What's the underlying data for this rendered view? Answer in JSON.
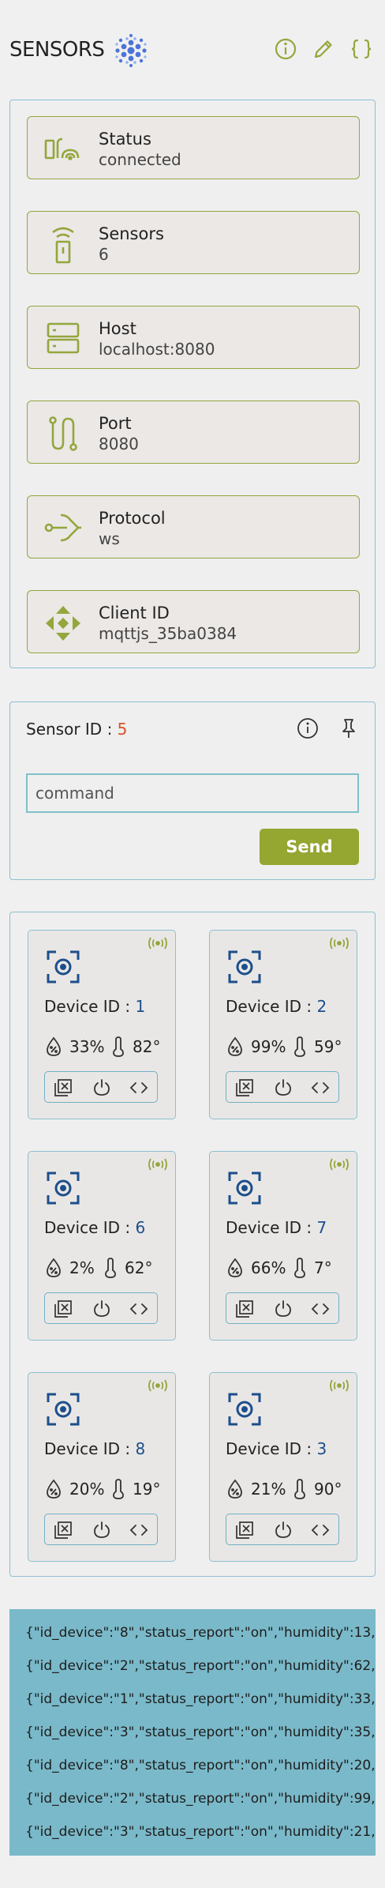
{
  "app": {
    "title": "SENSORS",
    "icons": [
      "logo-icon",
      "info-icon",
      "pencil-icon",
      "braces-icon"
    ]
  },
  "info_cards": [
    {
      "label": "Status",
      "value": "connected",
      "icon": "status-icon"
    },
    {
      "label": "Sensors",
      "value": "6",
      "icon": "sensor-device-icon"
    },
    {
      "label": "Host",
      "value": "localhost:8080",
      "icon": "server-icon"
    },
    {
      "label": "Port",
      "value": "8080",
      "icon": "port-icon"
    },
    {
      "label": "Protocol",
      "value": "ws",
      "icon": "protocol-icon"
    },
    {
      "label": "Client ID",
      "value": "mqttjs_35ba0384",
      "icon": "move-arrows-icon"
    }
  ],
  "command_panel": {
    "sensor_id_label": "Sensor ID : ",
    "sensor_id_value": "5",
    "input_placeholder": "command",
    "send_label": "Send",
    "icons": [
      "info-icon",
      "pin-icon"
    ]
  },
  "devices": [
    {
      "label": "Device ID : ",
      "id": "1",
      "humidity": "33%",
      "temperature": "82°"
    },
    {
      "label": "Device ID : ",
      "id": "2",
      "humidity": "99%",
      "temperature": "59°"
    },
    {
      "label": "Device ID : ",
      "id": "6",
      "humidity": "2%",
      "temperature": "62°"
    },
    {
      "label": "Device ID : ",
      "id": "7",
      "humidity": "66%",
      "temperature": "7°"
    },
    {
      "label": "Device ID : ",
      "id": "8",
      "humidity": "20%",
      "temperature": "19°"
    },
    {
      "label": "Device ID : ",
      "id": "3",
      "humidity": "21%",
      "temperature": "90°"
    }
  ],
  "log": [
    "{\"id_device\":\"8\",\"status_report\":\"on\",\"humidity\":13,\"temp",
    "{\"id_device\":\"2\",\"status_report\":\"on\",\"humidity\":62,\"temp",
    "{\"id_device\":\"1\",\"status_report\":\"on\",\"humidity\":33,\"temp",
    "{\"id_device\":\"3\",\"status_report\":\"on\",\"humidity\":35,\"temp",
    "{\"id_device\":\"8\",\"status_report\":\"on\",\"humidity\":20,\"temp",
    "{\"id_device\":\"2\",\"status_report\":\"on\",\"humidity\":99,\"temp",
    "{\"id_device\":\"3\",\"status_report\":\"on\",\"humidity\":21,\"temp"
  ],
  "colors": {
    "accent": "#95a631",
    "border": "#8cc0cf",
    "device_blue": "#1c4f8c",
    "sensor_id": "#d4532b",
    "log_bg": "#7ab9c9"
  }
}
